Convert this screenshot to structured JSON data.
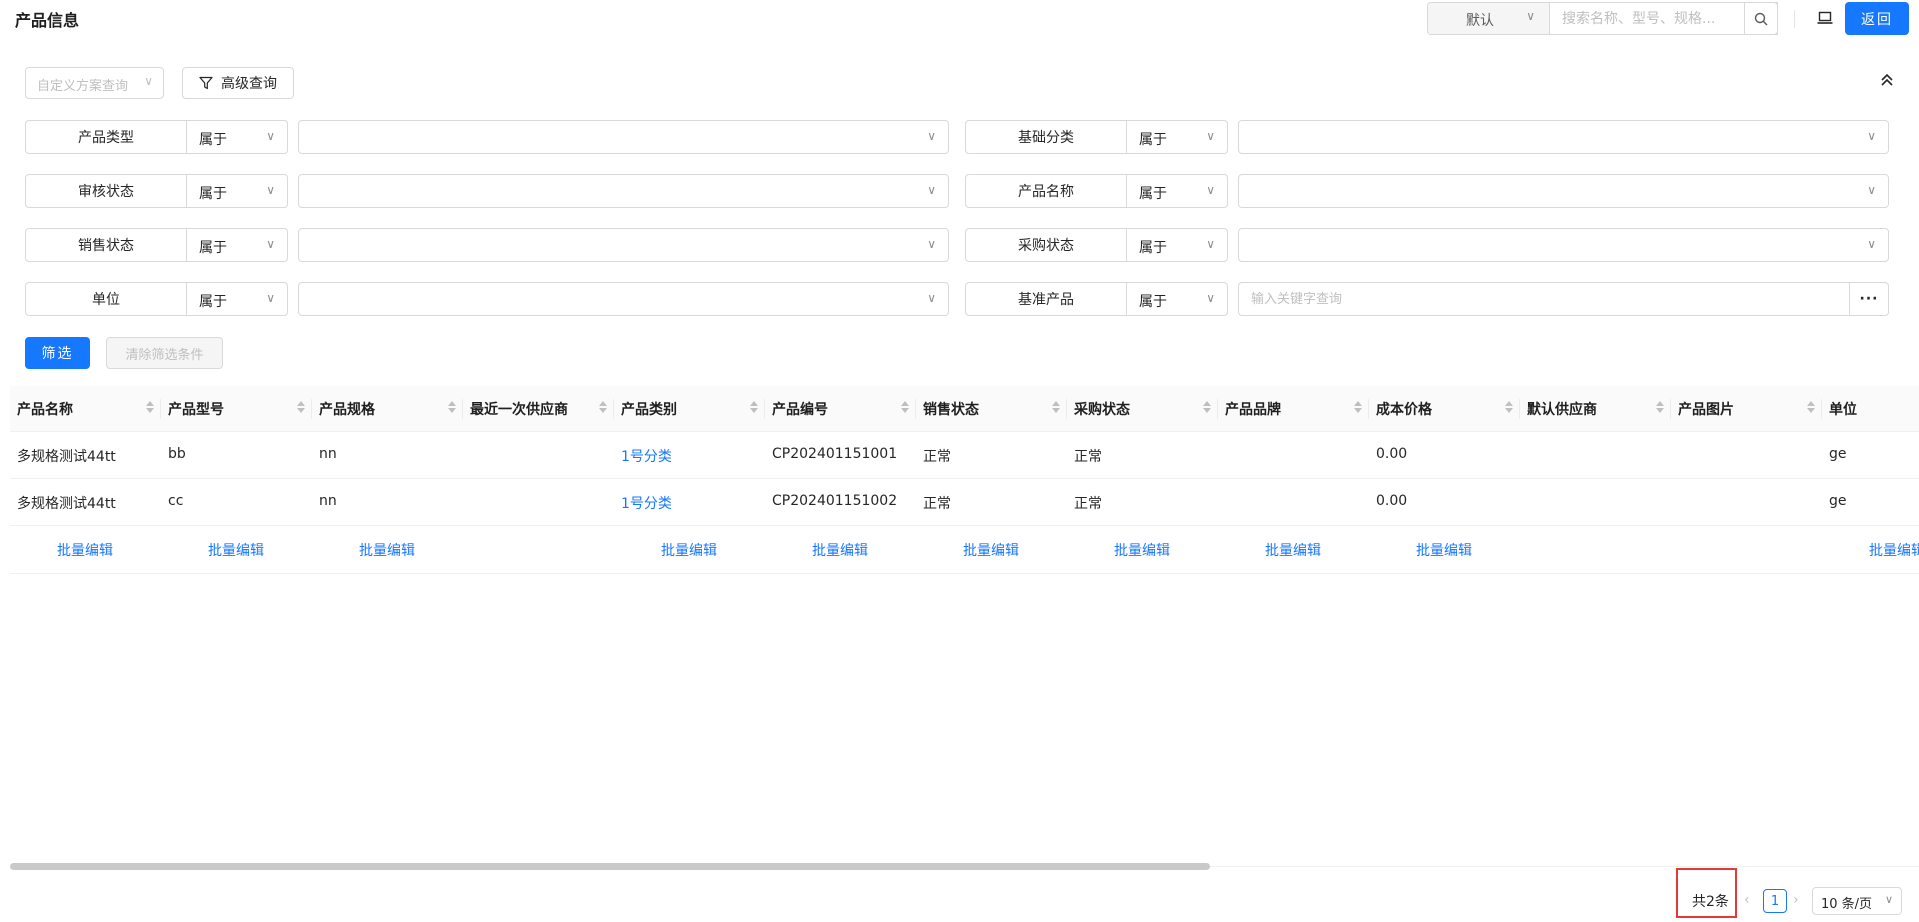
{
  "header": {
    "title": "产品信息",
    "view_select": "默认",
    "search_placeholder": "搜索名称、型号、规格...",
    "back_label": "返回"
  },
  "filter": {
    "scheme_placeholder": "自定义方案查询",
    "advanced_label": "高级查询",
    "rows": [
      {
        "left_label": "产品类型",
        "left_op": "属于",
        "right_label": "基础分类",
        "right_op": "属于"
      },
      {
        "left_label": "审核状态",
        "left_op": "属于",
        "right_label": "产品名称",
        "right_op": "属于"
      },
      {
        "left_label": "销售状态",
        "left_op": "属于",
        "right_label": "采购状态",
        "right_op": "属于"
      },
      {
        "left_label": "单位",
        "left_op": "属于",
        "right_label": "基准产品",
        "right_op": "属于",
        "right_placeholder": "输入关键字查询"
      }
    ],
    "filter_button": "筛选",
    "clear_button": "清除筛选条件"
  },
  "table": {
    "columns": [
      "产品名称",
      "产品型号",
      "产品规格",
      "最近一次供应商",
      "产品类别",
      "产品编号",
      "销售状态",
      "采购状态",
      "产品品牌",
      "成本价格",
      "默认供应商",
      "产品图片",
      "单位"
    ],
    "rows": [
      [
        "多规格测试44tt",
        "bb",
        "nn",
        "",
        "1号分类",
        "CP202401151001",
        "正常",
        "正常",
        "",
        "0.00",
        "",
        "",
        "ge"
      ],
      [
        "多规格测试44tt",
        "cc",
        "nn",
        "",
        "1号分类",
        "CP202401151002",
        "正常",
        "正常",
        "",
        "0.00",
        "",
        "",
        "ge"
      ]
    ],
    "batch_edit_label": "批量编辑"
  },
  "pagination": {
    "total_text": "共2条",
    "current_page": "1",
    "page_size": "10 条/页"
  },
  "colors": {
    "primary": "#1677ff",
    "highlight": "#e53935"
  }
}
